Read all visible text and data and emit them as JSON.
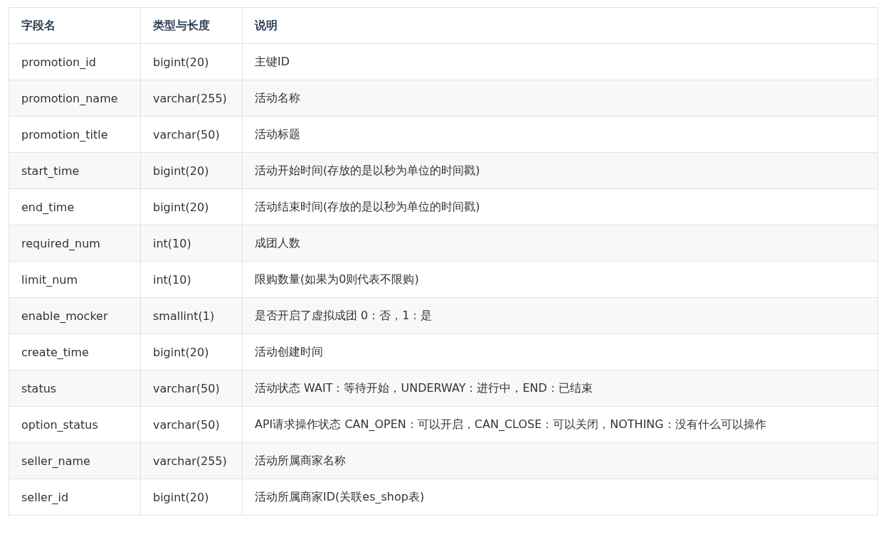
{
  "table": {
    "columns": [
      "字段名",
      "类型与长度",
      "说明"
    ],
    "rows": [
      [
        "promotion_id",
        "bigint(20)",
        "主键ID"
      ],
      [
        "promotion_name",
        "varchar(255)",
        "活动名称"
      ],
      [
        "promotion_title",
        "varchar(50)",
        "活动标题"
      ],
      [
        "start_time",
        "bigint(20)",
        "活动开始时间(存放的是以秒为单位的时间戳)"
      ],
      [
        "end_time",
        "bigint(20)",
        "活动结束时间(存放的是以秒为单位的时间戳)"
      ],
      [
        "required_num",
        "int(10)",
        "成团人数"
      ],
      [
        "limit_num",
        "int(10)",
        "限购数量(如果为0则代表不限购)"
      ],
      [
        "enable_mocker",
        "smallint(1)",
        "是否开启了虚拟成团 0：否，1：是"
      ],
      [
        "create_time",
        "bigint(20)",
        "活动创建时间"
      ],
      [
        "status",
        "varchar(50)",
        "活动状态 WAIT：等待开始，UNDERWAY：进行中，END：已结束"
      ],
      [
        "option_status",
        "varchar(50)",
        "API请求操作状态 CAN_OPEN：可以开启，CAN_CLOSE：可以关闭，NOTHING：没有什么可以操作"
      ],
      [
        "seller_name",
        "varchar(255)",
        "活动所属商家名称"
      ],
      [
        "seller_id",
        "bigint(20)",
        "活动所属商家ID(关联es_shop表)"
      ]
    ]
  }
}
